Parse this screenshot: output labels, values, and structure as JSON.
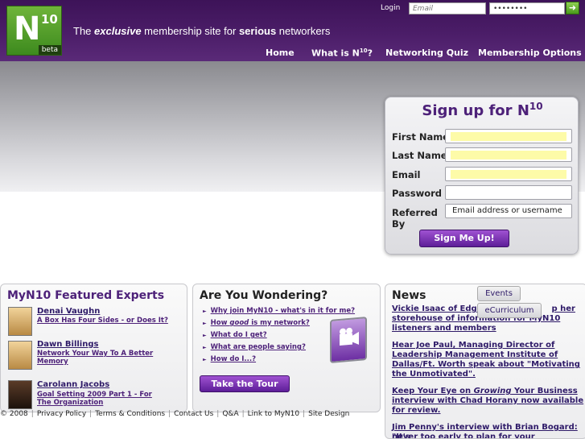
{
  "header": {
    "logo_main": "N",
    "logo_sup": "10",
    "logo_beta": "beta",
    "tagline_pre": "The ",
    "tagline_em": "exclusive",
    "tagline_mid": " membership site for ",
    "tagline_bold": "serious",
    "tagline_post": " networkers",
    "login_label": "Login",
    "email_placeholder": "Email",
    "password_value": "••••••••",
    "nav": {
      "home": "Home",
      "what_is": "What is N",
      "what_is_sup": "10",
      "what_is_post": "?",
      "quiz": "Networking Quiz",
      "membership": "Membership Options"
    }
  },
  "signup": {
    "title": "Sign up for N",
    "title_sup": "10",
    "first_name": "First Name",
    "last_name": "Last Name",
    "email": "Email",
    "password": "Password",
    "referred_by_1": "Referred",
    "referred_by_2": "By",
    "referred_placeholder": "Email address or username",
    "button": "Sign Me Up!"
  },
  "experts": {
    "title": "MyN10 Featured Experts",
    "items": [
      {
        "name": "Denai Vaughn",
        "sub": "A Box Has Four Sides - or Does It?"
      },
      {
        "name": "Dawn Billings",
        "sub1": "Network Your Way To A Better",
        "sub2": "Memory"
      },
      {
        "name": "Carolann Jacobs",
        "sub1": "Goal Setting 2009   Part 1 - For",
        "sub2": "The Organization"
      }
    ]
  },
  "wondering": {
    "title": "Are You Wondering?",
    "items": [
      "Why join MyN10 - what's in it for me?",
      "How ",
      "What do I get?",
      "What are people saying?",
      "How do I...?"
    ],
    "item2_em": "good",
    "item2_post": " is my network?",
    "tour_button": "Take the Tour"
  },
  "news": {
    "title": "News",
    "tab_events": "Events",
    "tab_curriculum": "eCurriculum",
    "items": [
      {
        "l1": "Vickie Isaac of Edge",
        "l1b": "p her",
        "l2": "storehouse of information for MyN10",
        "l3": "listeners and members"
      },
      {
        "l1": "Hear Joe Paul, Managing Director of",
        "l2": "Leadership Management Institute of",
        "l3": "Dallas/Ft. Worth speak about \"Motivating",
        "l4": "the Unmotivated\"."
      },
      {
        "l1_pre": "Keep Your Eye on ",
        "l1_em": "Growing",
        "l1_post": " Your Business",
        "l2": "interview with Chad Horany now available",
        "l3": "for review."
      },
      {
        "l1": "Jim Penny's interview with Brian Bogard: \"It's",
        "l2": "never too early to plan for your retirement\""
      }
    ]
  },
  "footer": {
    "copyright": "© 2008",
    "links": [
      "Privacy Policy",
      "Terms & Conditions",
      "Contact Us",
      "Q&A",
      "Link to MyN10",
      "Site Design"
    ]
  }
}
